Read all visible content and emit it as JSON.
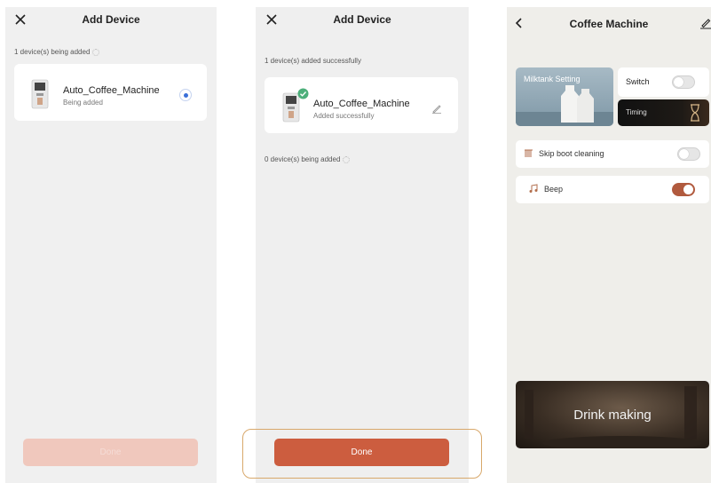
{
  "screen1": {
    "title": "Add Device",
    "status_text": "1 device(s) being added",
    "device": {
      "name": "Auto_Coffee_Machine",
      "status": "Being added"
    },
    "done_label": "Done"
  },
  "screen2": {
    "title": "Add Device",
    "success_text": "1 device(s) added successfully",
    "device": {
      "name": "Auto_Coffee_Machine",
      "status": "Added successfully"
    },
    "adding_text": "0 device(s) being added",
    "done_label": "Done"
  },
  "screen3": {
    "title": "Coffee Machine",
    "milktank_label": "Milktank Setting",
    "switch_label": "Switch",
    "timing_label": "Timing",
    "skip_boot_label": "Skip boot cleaning",
    "beep_label": "Beep",
    "drink_making_label": "Drink making",
    "switch_on": false,
    "skip_boot_on": false,
    "beep_on": true
  },
  "colors": {
    "accent": "#cc5d3f",
    "accent_disabled": "#f0c8bd",
    "toggle_on": "#b15a3e",
    "highlight": "#d8a86b",
    "success": "#4caf7a"
  },
  "icons": [
    "close-icon",
    "back-icon",
    "edit-icon",
    "spinner-icon",
    "check-icon",
    "radio-icon",
    "milk-icon",
    "beep-icon"
  ]
}
